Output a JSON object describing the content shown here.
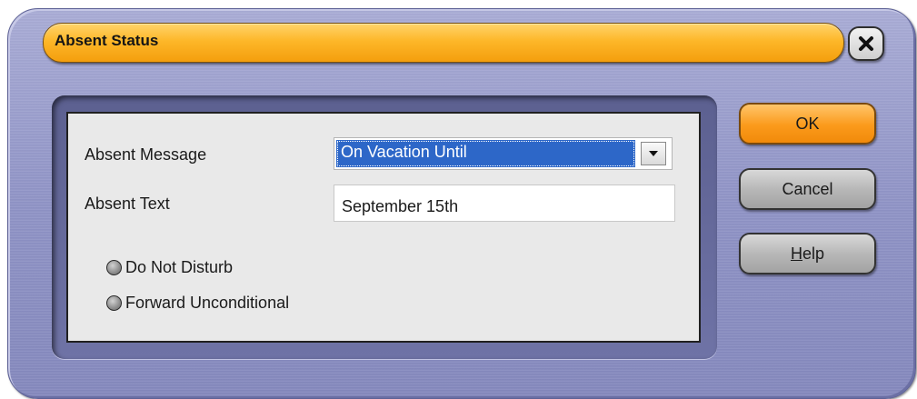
{
  "window": {
    "title": "Absent Status"
  },
  "form": {
    "absent_message_label": "Absent Message",
    "absent_message_value": "On Vacation Until",
    "absent_text_label": "Absent Text",
    "absent_text_value": "September 15th",
    "options": [
      {
        "label": "Do Not Disturb"
      },
      {
        "label": "Forward Unconditional"
      }
    ]
  },
  "buttons": {
    "ok_label": "OK",
    "cancel_label": "Cancel",
    "help_mnemonic": "H",
    "help_rest": "elp"
  },
  "icons": {
    "close": "close-x-icon",
    "dropdown": "triangle-down-icon"
  },
  "colors": {
    "title_bar": "#fdb729",
    "ok_button": "#fb9a1b",
    "selection": "#2d67c8",
    "dialog_frame": "#8f93c6"
  }
}
